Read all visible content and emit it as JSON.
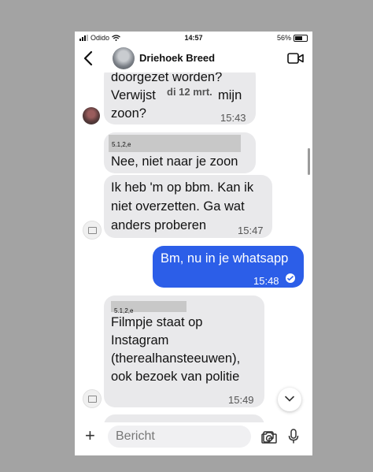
{
  "status": {
    "carrier": "Odido",
    "time": "14:57",
    "battery": "56%"
  },
  "header": {
    "title": "Driehoek Breed"
  },
  "date_separator": "di 12 mrt.",
  "messages": [
    {
      "line1": "doorgezet worden?",
      "line2": "Verwijst",
      "line2b": "mijn",
      "line3": "zoon?",
      "time": "15:43"
    },
    {
      "redacted_label": "5.1,2,e",
      "text": "Nee, niet naar je zoon"
    },
    {
      "line1": "Ik heb 'm op bbm. Kan ik",
      "line2": "niet overzetten. Ga wat",
      "line3": "anders proberen",
      "time": "15:47"
    },
    {
      "text": "Bm, nu in je whatsapp",
      "time": "15:48"
    },
    {
      "redacted_label": "5.1,2,e",
      "line1": "Filmpje staat op",
      "line2": "Instagram",
      "line3": "(therealhansteeuwen),",
      "line4": "ook bezoek van politie",
      "time": "15:49"
    }
  ],
  "composer": {
    "placeholder": "Bericht"
  }
}
